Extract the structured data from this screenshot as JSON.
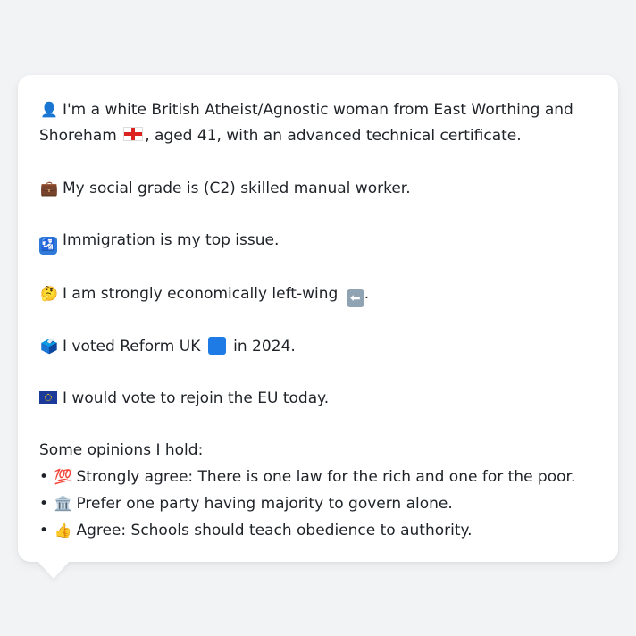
{
  "profile": {
    "intro_line1_text": "I'm a white British Atheist/Agnostic woman from East Worthing and",
    "intro_line2_a": "Shoreham",
    "intro_line2_b": ", aged 41, with an advanced technical certificate.",
    "social_grade": "My social grade is (C2) skilled manual worker.",
    "top_issue": "Immigration is my top issue.",
    "economics_a": "I am strongly economically left-wing",
    "economics_b": ".",
    "vote_a": "I voted Reform UK",
    "vote_b": "in 2024.",
    "eu": "I would vote to rejoin the EU today."
  },
  "opinions": {
    "heading": "Some opinions I hold:",
    "items": [
      {
        "text": "Strongly agree: There is one law for the rich and one for the poor."
      },
      {
        "text": "Prefer one party having majority to govern alone."
      },
      {
        "text": "Agree: Schools should teach obedience to authority."
      }
    ]
  },
  "icons": {
    "person": "👤",
    "briefcase": "💼",
    "thinking": "🤔",
    "ballot": "🗳️",
    "hundred": "💯",
    "bank": "🏛️",
    "thumbs": "👍"
  },
  "colors": {
    "page_background": "#f2f3f5",
    "card_background": "#ffffff",
    "text": "#1f2328",
    "reform_blue": "#1e7be5"
  }
}
